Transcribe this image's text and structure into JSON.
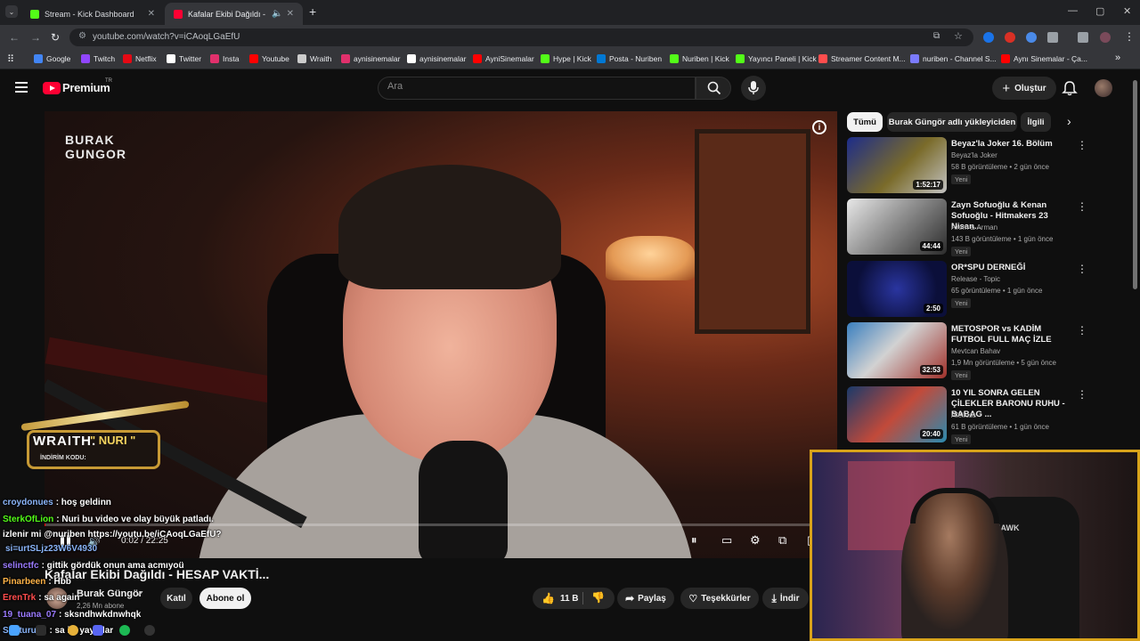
{
  "browser": {
    "tabs": [
      {
        "title": "Stream - Kick Dashboard",
        "favicon_color": "#53fc18"
      },
      {
        "title": "Kafalar Ekibi Dağıldı - HESA",
        "favicon_color": "#ff0033"
      }
    ],
    "url": "youtube.com/watch?v=iCAoqLGaEfU",
    "bookmarks": [
      {
        "label": "Google",
        "color": "#4285f4"
      },
      {
        "label": "Twitch",
        "color": "#9146ff"
      },
      {
        "label": "Netflix",
        "color": "#e50914"
      },
      {
        "label": "Twitter",
        "color": "#ffffff"
      },
      {
        "label": "Insta",
        "color": "#e1306c"
      },
      {
        "label": "Youtube",
        "color": "#ff0000"
      },
      {
        "label": "Wraith",
        "color": "#cccccc"
      },
      {
        "label": "aynisinemalar",
        "color": "#e1306c"
      },
      {
        "label": "aynisinemalar",
        "color": "#ffffff"
      },
      {
        "label": "AyniSinemalar",
        "color": "#ff0000"
      },
      {
        "label": "Hype | Kick",
        "color": "#53fc18"
      },
      {
        "label": "Posta - Nuriben",
        "color": "#0078d4"
      },
      {
        "label": "Nuriben | Kick",
        "color": "#53fc18"
      },
      {
        "label": "Yayıncı Paneli | Kick",
        "color": "#53fc18"
      },
      {
        "label": "Streamer Content M...",
        "color": "#ff4d4d"
      },
      {
        "label": "nuriben - Channel S...",
        "color": "#7b7bff"
      },
      {
        "label": "Aynı Sinemalar - Ça...",
        "color": "#ff0000"
      }
    ]
  },
  "youtube": {
    "logo_text": "Premium",
    "logo_sup": "TR",
    "search_placeholder": "Ara",
    "create_label": "Oluştur"
  },
  "player": {
    "watermark_line1": "BURAK",
    "watermark_line2": "GUNGOR",
    "time": "0:02 / 22:25",
    "progress_fraction": 0.0015
  },
  "video": {
    "title": "Kafalar Ekibi Dağıldı - HESAP VAKTİ...",
    "channel": "Burak Güngör",
    "subscribers": "2,26 Mn abone",
    "join_label": "Katıl",
    "subscribe_label": "Abone ol",
    "likes": "11 B",
    "share_label": "Paylaş",
    "thanks_label": "Teşekkürler",
    "download_label": "İndir"
  },
  "chips": [
    "Tümü",
    "Burak Güngör adlı yükleyiciden",
    "İlgili"
  ],
  "related": [
    {
      "title": "Beyaz'la Joker 16. Bölüm",
      "channel": "Beyaz'la Joker",
      "meta": "58 B görüntüleme • 2 gün önce",
      "badge": "Yeni",
      "duration": "1:52:17",
      "thumb": "linear-gradient(135deg,#1c2c8a,#7a6b2a 55%,#c2c2c2)"
    },
    {
      "title": "Zayn Sofuoğlu & Kenan Sofuoğlu - Hitmakers 23 Nisan...",
      "channel": "Arem & Arman",
      "meta": "143 B görüntüleme • 1 gün önce",
      "badge": "Yeni",
      "duration": "44:44",
      "thumb": "linear-gradient(135deg,#e8e8e8,#9b9b9b 40%,#2b2b2b)"
    },
    {
      "title": "OR*SPU DERNEĞİ",
      "channel": "Release - Topic",
      "meta": "65 görüntüleme • 1 gün önce",
      "badge": "Yeni",
      "duration": "2:50",
      "thumb": "radial-gradient(circle,#2a35a0,#0b0f3a 70%)"
    },
    {
      "title": "METOSPOR vs KADİM FUTBOL FULL MAÇ İZLE",
      "channel": "Mevtcan Bahav",
      "meta": "1,9 Mn görüntüleme • 5 gün önce",
      "badge": "Yeni",
      "duration": "32:53",
      "thumb": "linear-gradient(135deg,#3a7fbf,#d2d2d2 45%,#a0302a)"
    },
    {
      "title": "10 YIL SONRA GELEN ÇİLEKLER BARONU RUHU - BABAG ...",
      "channel": "Afelioss",
      "meta": "61 B görüntüleme • 1 gün önce",
      "badge": "Yeni",
      "duration": "20:40",
      "thumb": "linear-gradient(135deg,#1a3a6a,#c24a3a 50%,#2a8ab0)"
    }
  ],
  "overlay": {
    "promo_brand": "WRAITH.",
    "promo_code": "\" NURI \"",
    "promo_label": "İNDİRİM KODU:",
    "cam_brand": "HAWK",
    "chat": [
      {
        "user": "croydonues",
        "text": ": hoş geldinn",
        "color": "#8ab4f8"
      },
      {
        "user": "SterkOfLion",
        "text": ": Nuri bu video ve olay büyük patladı.",
        "color": "#53fc18"
      },
      {
        "user": "izlenir mi",
        "text": "@nuriben https://youtu.be/iCAoqLGaEfU?",
        "color": "#ffffff"
      },
      {
        "user": "",
        "text": "si=urtSLjz23W6V4930",
        "color": "#8ab4f8"
      },
      {
        "user": "selinctfc",
        "text": ": gittik gördük onun ama acmıyoü",
        "color": "#9b7bff"
      },
      {
        "user": "Pinarbeen",
        "text": ": Hbb",
        "color": "#ffb347"
      },
      {
        "user": "ErenTrk",
        "text": ": sa again",
        "color": "#ff4d4d"
      },
      {
        "user": "19_tuana_07",
        "text": ": sksndhwkdnwhqk",
        "color": "#9b7bff"
      },
      {
        "user": "Susturucu",
        "text": ": sa iyi yayınlar",
        "color": "#8ab4f8"
      }
    ]
  }
}
